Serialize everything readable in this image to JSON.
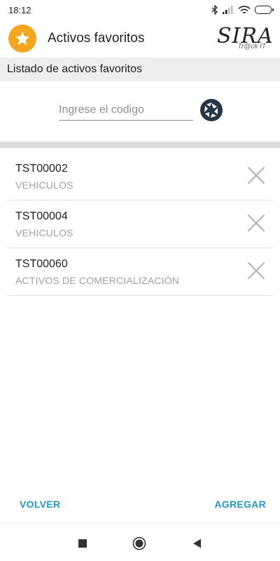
{
  "status_bar": {
    "time": "18:12"
  },
  "app_bar": {
    "title": "Activos favoritos",
    "logo_text": "SIRA",
    "logo_subtext": "Tr@ck IT"
  },
  "section": {
    "header": "Listado de activos favoritos"
  },
  "search": {
    "value": "",
    "placeholder": "Ingrese el codigo"
  },
  "assets": [
    {
      "code": "TST00002",
      "category": "VEHICULOS"
    },
    {
      "code": "TST00004",
      "category": "VEHICULOS"
    },
    {
      "code": "TST00060",
      "category": "ACTIVOS DE COMERCIALIZACIÓN"
    }
  ],
  "footer": {
    "back_label": "VOLVER",
    "add_label": "AGREGAR"
  },
  "colors": {
    "accent": "#f4a623",
    "action": "#2196c9",
    "secondary_text": "#9e9e9e"
  },
  "icons": {
    "app": "star-icon",
    "scan": "camera-shutter-icon",
    "remove": "close-icon"
  }
}
